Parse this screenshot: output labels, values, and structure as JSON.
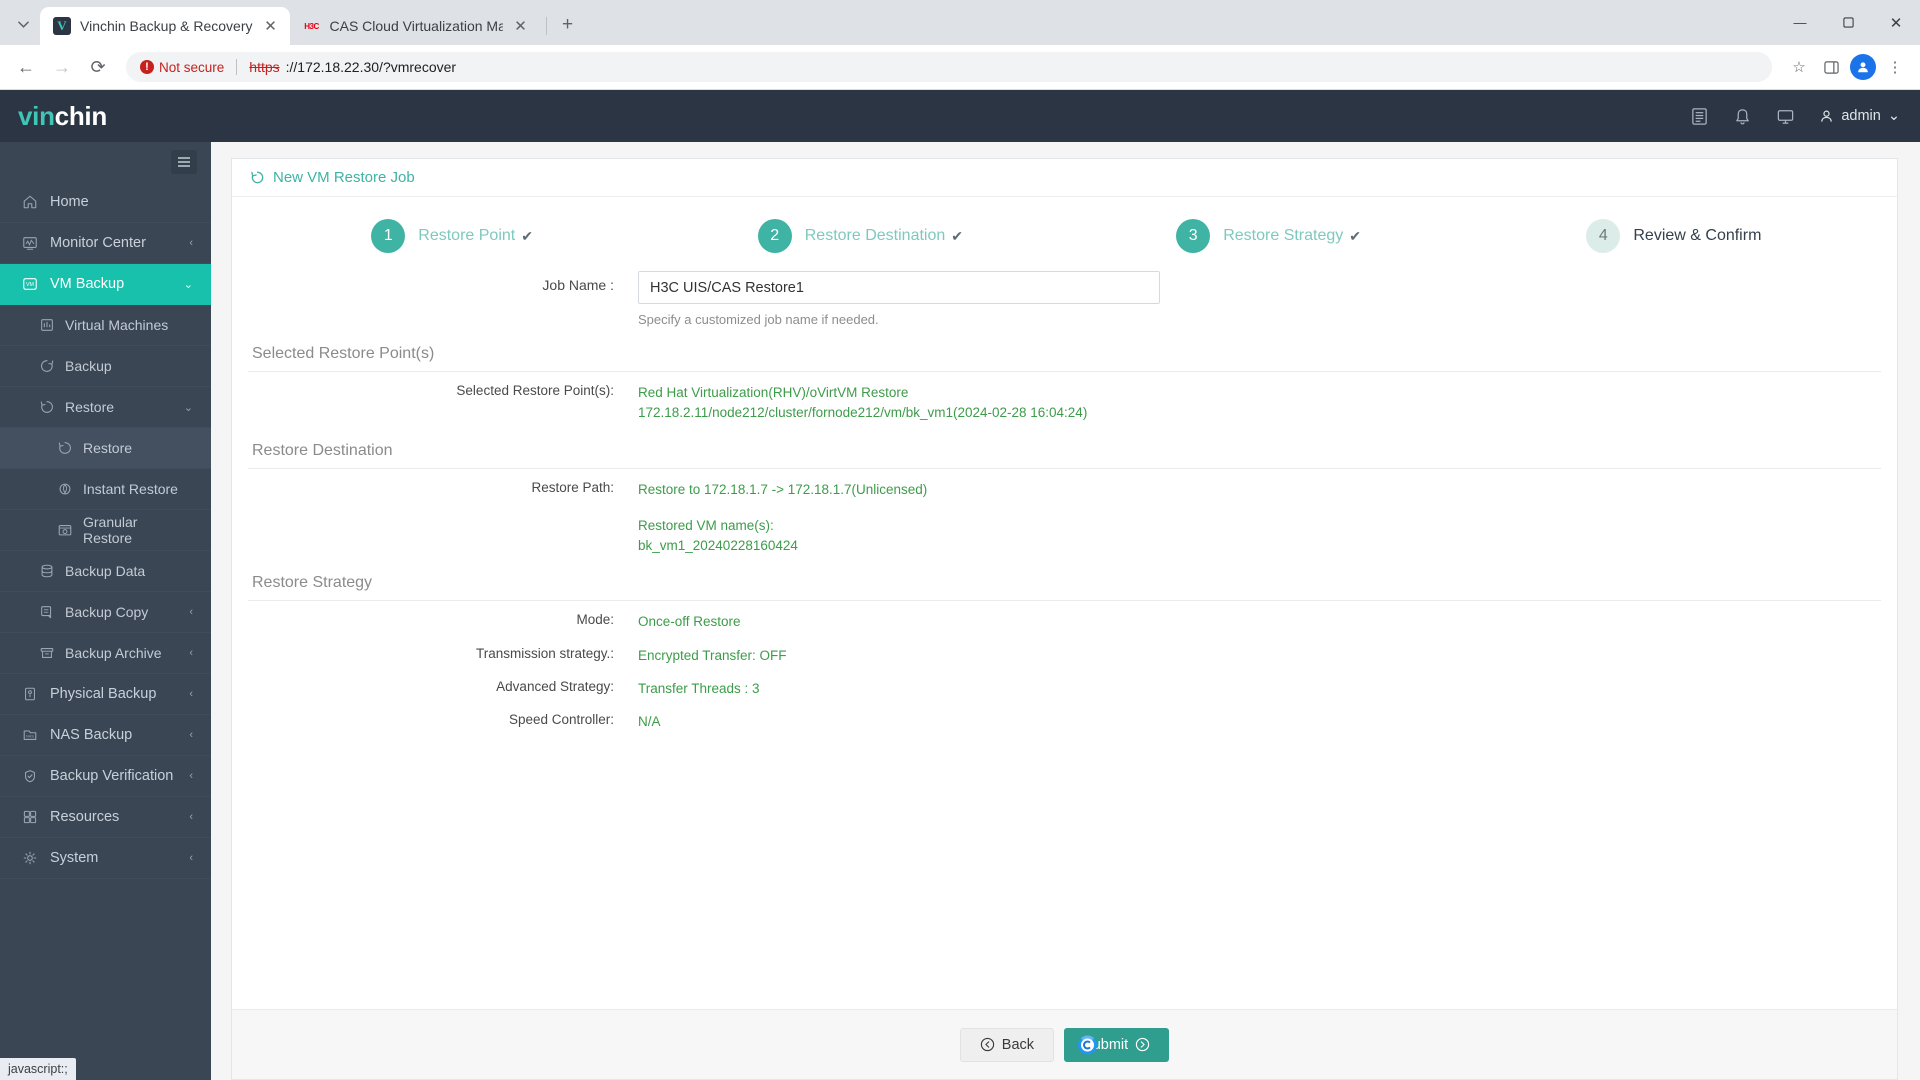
{
  "browser": {
    "tabs": [
      {
        "title": "Vinchin Backup & Recovery",
        "favicon": "V",
        "active": true
      },
      {
        "title": "CAS Cloud Virtualization Manag",
        "favicon": "H3C",
        "active": false
      }
    ],
    "new_tab_label": "+",
    "tab_list_icon": "chevron-down-icon",
    "window": {
      "minimize": "—",
      "maximize": "❐",
      "close": "✕"
    },
    "nav": {
      "back": "←",
      "forward": "→",
      "reload": "⟳"
    },
    "omnibox": {
      "security_label": "Not secure",
      "security_icon": "!",
      "url_scheme": "https",
      "url_rest": "://172.18.22.30/?vmrecover"
    },
    "toolbar_right": {
      "bookmark": "☆",
      "sidepanel": "❑",
      "profile": "●",
      "menu": "⋮"
    },
    "status_text": "javascript:;"
  },
  "app": {
    "logo": {
      "part1": "vin",
      "part2": "chin"
    },
    "header_icons": [
      {
        "name": "reports-icon",
        "glyph": "☰"
      },
      {
        "name": "notification-bell-icon",
        "glyph": "🔔"
      },
      {
        "name": "monitor-icon",
        "glyph": "⎕"
      }
    ],
    "user": {
      "name": "admin",
      "caret": "⌄"
    }
  },
  "sidebar": {
    "hamburger_icon": "hamburger-icon",
    "items": [
      {
        "label": "Home",
        "icon": "home-icon",
        "level": 1,
        "state": "normal",
        "caret": ""
      },
      {
        "label": "Monitor Center",
        "icon": "monitor-center-icon",
        "level": 1,
        "state": "normal",
        "caret": "‹"
      },
      {
        "label": "VM Backup",
        "icon": "vm-icon",
        "level": 1,
        "state": "active",
        "caret": "⌄"
      },
      {
        "label": "Virtual Machines",
        "icon": "virtual-machines-icon",
        "level": 2,
        "state": "normal",
        "caret": ""
      },
      {
        "label": "Backup",
        "icon": "backup-icon",
        "level": 2,
        "state": "normal",
        "caret": ""
      },
      {
        "label": "Restore",
        "icon": "restore-icon",
        "level": 2,
        "state": "normal",
        "caret": "⌄"
      },
      {
        "label": "Restore",
        "icon": "restore-icon",
        "level": 3,
        "state": "selected",
        "caret": ""
      },
      {
        "label": "Instant Restore",
        "icon": "instant-restore-icon",
        "level": 3,
        "state": "normal",
        "caret": ""
      },
      {
        "label": "Granular Restore",
        "icon": "granular-restore-icon",
        "level": 3,
        "state": "normal",
        "caret": ""
      },
      {
        "label": "Backup Data",
        "icon": "database-icon",
        "level": 2,
        "state": "normal",
        "caret": ""
      },
      {
        "label": "Backup Copy",
        "icon": "copy-icon",
        "level": 2,
        "state": "normal",
        "caret": "‹"
      },
      {
        "label": "Backup Archive",
        "icon": "archive-icon",
        "level": 2,
        "state": "normal",
        "caret": "‹"
      },
      {
        "label": "Physical Backup",
        "icon": "server-icon",
        "level": 1,
        "state": "normal",
        "caret": "‹"
      },
      {
        "label": "NAS Backup",
        "icon": "nas-icon",
        "level": 1,
        "state": "normal",
        "caret": "‹"
      },
      {
        "label": "Backup Verification",
        "icon": "shield-check-icon",
        "level": 1,
        "state": "normal",
        "caret": "‹"
      },
      {
        "label": "Resources",
        "icon": "resources-icon",
        "level": 1,
        "state": "normal",
        "caret": "‹"
      },
      {
        "label": "System",
        "icon": "system-icon",
        "level": 1,
        "state": "normal",
        "caret": "‹"
      }
    ]
  },
  "page": {
    "title": "New VM Restore Job",
    "title_icon": "restore-icon",
    "steps": [
      {
        "number": "1",
        "label": "Restore Point",
        "check": "✔",
        "state": "done"
      },
      {
        "number": "2",
        "label": "Restore Destination",
        "check": "✔",
        "state": "done"
      },
      {
        "number": "3",
        "label": "Restore Strategy",
        "check": "✔",
        "state": "done"
      },
      {
        "number": "4",
        "label": "Review & Confirm",
        "check": "",
        "state": "todo"
      }
    ],
    "job_name": {
      "label": "Job Name :",
      "value": "H3C UIS/CAS Restore1",
      "placeholder": "",
      "hint": "Specify a customized job name if needed."
    },
    "sections": [
      {
        "heading": "Selected Restore Point(s)",
        "rows": [
          {
            "label": "Selected Restore Point(s):",
            "lines": [
              "Red Hat Virtualization(RHV)/oVirtVM Restore",
              "172.18.2.11/node212/cluster/fornode212/vm/bk_vm1(2024-02-28 16:04:24)"
            ]
          }
        ]
      },
      {
        "heading": "Restore Destination",
        "rows": [
          {
            "label": "Restore Path:",
            "lines": [
              "Restore to 172.18.1.7 -> 172.18.1.7(Unlicensed)",
              "",
              "Restored VM name(s):",
              "bk_vm1_20240228160424"
            ]
          }
        ]
      },
      {
        "heading": "Restore Strategy",
        "rows": [
          {
            "label": "Mode:",
            "lines": [
              "Once-off Restore"
            ]
          },
          {
            "label": "Transmission strategy.:",
            "lines": [
              "Encrypted Transfer: OFF"
            ]
          },
          {
            "label": "Advanced Strategy:",
            "lines": [
              "Transfer Threads : 3"
            ]
          },
          {
            "label": "Speed Controller:",
            "lines": [
              "N/A"
            ]
          }
        ]
      }
    ],
    "footer": {
      "back_label": "Back",
      "back_icon": "←",
      "submit_label": "Submit",
      "submit_icon": "→"
    }
  },
  "colors": {
    "brand_teal": "#18c1ab",
    "step_teal": "#3fb3a4",
    "sidebar_bg": "#3a4654",
    "header_bg": "#2b3543",
    "value_green": "#3d9c4a",
    "submit_bg": "#2f9e8f"
  }
}
